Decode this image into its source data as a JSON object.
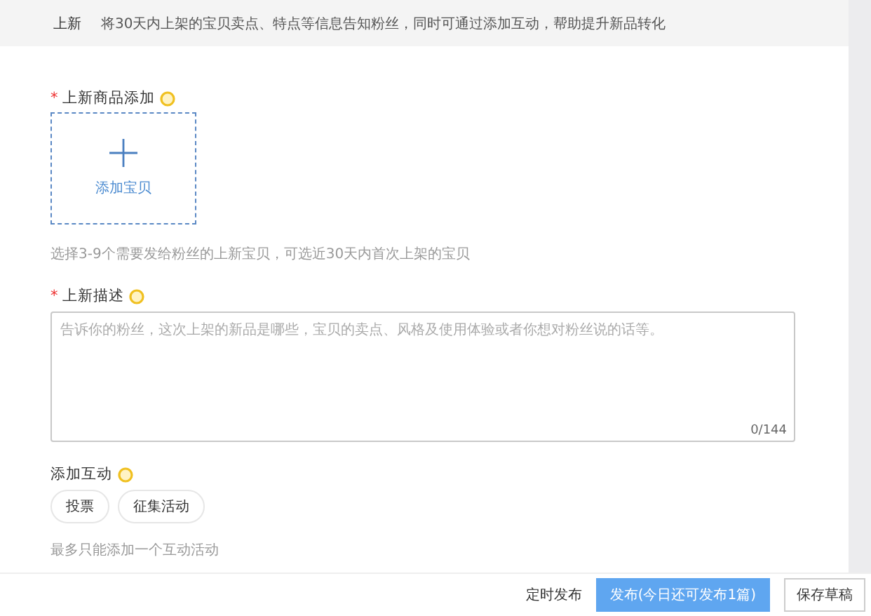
{
  "header": {
    "title": "上新",
    "description": "将30天内上架的宝贝卖点、特点等信息告知粉丝，同时可通过添加互动，帮助提升新品转化"
  },
  "product_section": {
    "label": "上新商品添加",
    "required_mark": "*",
    "add_button": "添加宝贝",
    "hint": "选择3-9个需要发给粉丝的上新宝贝，可选近30天内首次上架的宝贝"
  },
  "description_section": {
    "label": "上新描述",
    "required_mark": "*",
    "placeholder": "告诉你的粉丝，这次上架的新品是哪些，宝贝的卖点、风格及使用体验或者你想对粉丝说的话等。",
    "counter": "0/144"
  },
  "interaction_section": {
    "label": "添加互动",
    "options": [
      "投票",
      "征集活动"
    ],
    "hint": "最多只能添加一个互动活动"
  },
  "footer": {
    "schedule": "定时发布",
    "publish": "发布(今日还可发布1篇)",
    "save_draft": "保存草稿"
  }
}
